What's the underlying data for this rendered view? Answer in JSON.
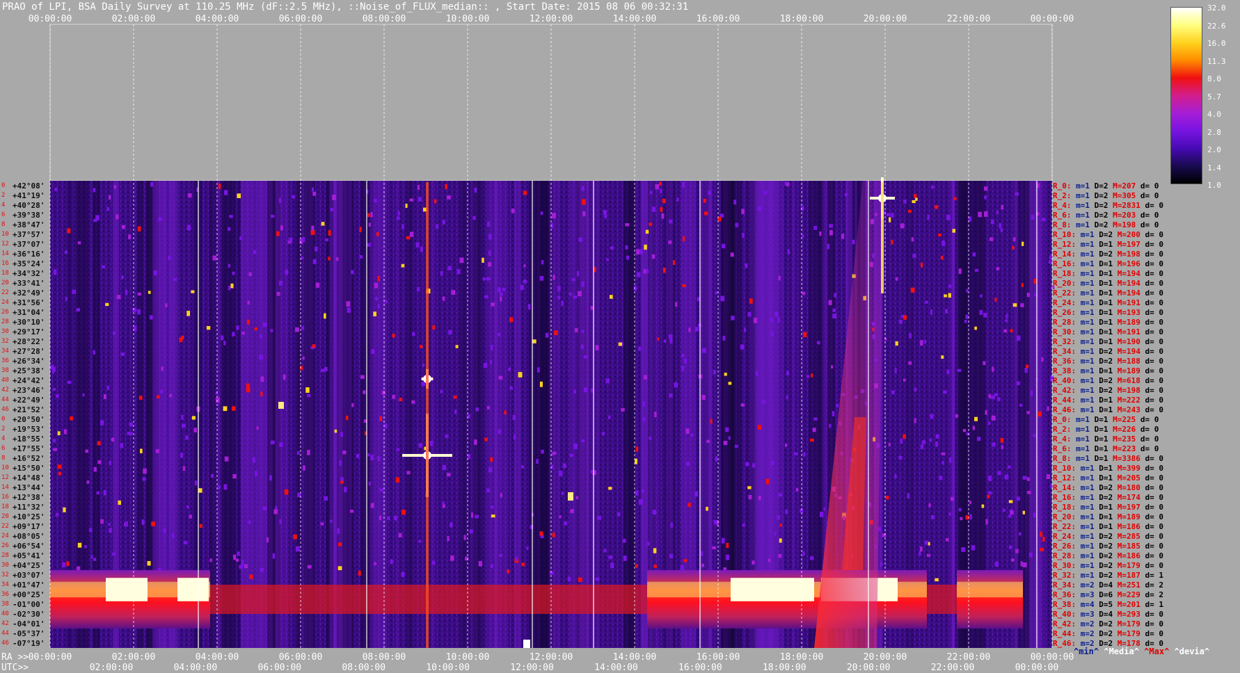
{
  "title": "PRAO of LPI, BSA Daily Survey at 110.25 MHz (dF::2.5 MHz), ::Noise_of_FLUX_median:: , Start Date: 2015 08 06 00:32:31",
  "chart_data": {
    "type": "heatmap",
    "title": "PRAO of LPI, BSA Daily Survey at 110.25 MHz (dF::2.5 MHz), ::Noise_of_FLUX_median:: , Start Date: 2015 08 06 00:32:31",
    "x_axis_top_ticks": [
      "00:00:00",
      "02:00:00",
      "04:00:00",
      "06:00:00",
      "08:00:00",
      "10:00:00",
      "12:00:00",
      "14:00:00",
      "16:00:00",
      "18:00:00",
      "20:00:00",
      "22:00:00",
      "00:00:00"
    ],
    "x_axis_bottom_ra_ticks": [
      "00:00:00",
      "02:00:00",
      "04:00:00",
      "06:00:00",
      "08:00:00",
      "10:00:00",
      "12:00:00",
      "14:00:00",
      "16:00:00",
      "18:00:00",
      "20:00:00",
      "22:00:00",
      "00:00:00"
    ],
    "x_axis_bottom_utc_ticks": [
      "02:00:00",
      "04:00:00",
      "06:00:00",
      "08:00:00",
      "10:00:00",
      "12:00:00",
      "14:00:00",
      "16:00:00",
      "18:00:00",
      "20:00:00",
      "22:00:00",
      "00:00:00"
    ],
    "ra_label": "RA >>",
    "utc_label": "UTC>>",
    "colorbar": {
      "ticks": [
        "32.0",
        "22.6",
        "16.0",
        "11.3",
        "8.0",
        "5.7",
        "4.0",
        "2.8",
        "2.0",
        "1.4",
        "1.0"
      ],
      "colors": [
        "#ffffff",
        "#ffff80",
        "#ffd21e",
        "#ff8c00",
        "#f01010",
        "#d21e8c",
        "#a51ed7",
        "#7814e1",
        "#460ab4",
        "#190a50",
        "#000000"
      ]
    },
    "declinations": [
      "+42°08'",
      "+41°19'",
      "+40°28'",
      "+39°38'",
      "+38°47'",
      "+37°57'",
      "+37°07'",
      "+36°16'",
      "+35°24'",
      "+34°32'",
      "+33°41'",
      "+32°49'",
      "+31°56'",
      "+31°04'",
      "+30°10'",
      "+29°17'",
      "+28°22'",
      "+27°28'",
      "+26°34'",
      "+25°38'",
      "+24°42'",
      "+23°46'",
      "+22°49'",
      "+21°52'",
      "+20°50'",
      "+19°53'",
      "+18°55'",
      "+17°55'",
      "+16°52'",
      "+15°50'",
      "+14°48'",
      "+13°44'",
      "+12°38'",
      "+11°32'",
      "+10°25'",
      "+09°17'",
      "+08°05'",
      "+06°54'",
      "+05°41'",
      "+04°25'",
      "+03°07'",
      "+01°47'",
      "+00°25'",
      "-01°00'",
      "-02°30'",
      "-04°01'",
      "-05°37'",
      "-07°19'"
    ],
    "row_indices": [
      "0",
      "2",
      "4",
      "6",
      "8",
      "10",
      "12",
      "14",
      "16",
      "18",
      "20",
      "22",
      "24",
      "26",
      "28",
      "30",
      "32",
      "34",
      "36",
      "38",
      "40",
      "42",
      "44",
      "46",
      "0",
      "2",
      "4",
      "6",
      "8",
      "10",
      "12",
      "14",
      "16",
      "18",
      "20",
      "22",
      "24",
      "26",
      "28",
      "30",
      "32",
      "34",
      "36",
      "38",
      "40",
      "42",
      "44",
      "46"
    ],
    "rows": [
      {
        "r": "R_0:",
        "m": "m=1",
        "D": "D=2",
        "M": "M=207",
        "d": "d= 0"
      },
      {
        "r": "R_2:",
        "m": "m=1",
        "D": "D=2",
        "M": "M=305",
        "d": "d= 0"
      },
      {
        "r": "R_4:",
        "m": "m=1",
        "D": "D=2",
        "M": "M=2831",
        "d": "d= 0"
      },
      {
        "r": "R_6:",
        "m": "m=1",
        "D": "D=2",
        "M": "M=203",
        "d": "d= 0"
      },
      {
        "r": "R_8:",
        "m": "m=1",
        "D": "D=2",
        "M": "M=198",
        "d": "d= 0"
      },
      {
        "r": "R_10:",
        "m": "m=1",
        "D": "D=2",
        "M": "M=200",
        "d": "d= 0"
      },
      {
        "r": "R_12:",
        "m": "m=1",
        "D": "D=1",
        "M": "M=197",
        "d": "d= 0"
      },
      {
        "r": "R_14:",
        "m": "m=1",
        "D": "D=2",
        "M": "M=198",
        "d": "d= 0"
      },
      {
        "r": "R_16:",
        "m": "m=1",
        "D": "D=1",
        "M": "M=196",
        "d": "d= 0"
      },
      {
        "r": "R_18:",
        "m": "m=1",
        "D": "D=1",
        "M": "M=194",
        "d": "d= 0"
      },
      {
        "r": "R_20:",
        "m": "m=1",
        "D": "D=1",
        "M": "M=194",
        "d": "d= 0"
      },
      {
        "r": "R_22:",
        "m": "m=1",
        "D": "D=1",
        "M": "M=194",
        "d": "d= 0"
      },
      {
        "r": "R_24:",
        "m": "m=1",
        "D": "D=1",
        "M": "M=191",
        "d": "d= 0"
      },
      {
        "r": "R_26:",
        "m": "m=1",
        "D": "D=1",
        "M": "M=193",
        "d": "d= 0"
      },
      {
        "r": "R_28:",
        "m": "m=1",
        "D": "D=1",
        "M": "M=189",
        "d": "d= 0"
      },
      {
        "r": "R_30:",
        "m": "m=1",
        "D": "D=1",
        "M": "M=191",
        "d": "d= 0"
      },
      {
        "r": "R_32:",
        "m": "m=1",
        "D": "D=1",
        "M": "M=190",
        "d": "d= 0"
      },
      {
        "r": "R_34:",
        "m": "m=1",
        "D": "D=2",
        "M": "M=194",
        "d": "d= 0"
      },
      {
        "r": "R_36:",
        "m": "m=1",
        "D": "D=2",
        "M": "M=188",
        "d": "d= 0"
      },
      {
        "r": "R_38:",
        "m": "m=1",
        "D": "D=1",
        "M": "M=189",
        "d": "d= 0"
      },
      {
        "r": "R_40:",
        "m": "m=1",
        "D": "D=2",
        "M": "M=618",
        "d": "d= 0"
      },
      {
        "r": "R_42:",
        "m": "m=1",
        "D": "D=2",
        "M": "M=198",
        "d": "d= 0"
      },
      {
        "r": "R_44:",
        "m": "m=1",
        "D": "D=1",
        "M": "M=222",
        "d": "d= 0"
      },
      {
        "r": "R_46:",
        "m": "m=1",
        "D": "D=1",
        "M": "M=243",
        "d": "d= 0"
      },
      {
        "r": "R_0:",
        "m": "m=1",
        "D": "D=1",
        "M": "M=225",
        "d": "d= 0"
      },
      {
        "r": "R_2:",
        "m": "m=1",
        "D": "D=1",
        "M": "M=226",
        "d": "d= 0"
      },
      {
        "r": "R_4:",
        "m": "m=1",
        "D": "D=1",
        "M": "M=235",
        "d": "d= 0"
      },
      {
        "r": "R_6:",
        "m": "m=1",
        "D": "D=1",
        "M": "M=223",
        "d": "d= 0"
      },
      {
        "r": "R_8:",
        "m": "m=1",
        "D": "D=1",
        "M": "M=3386",
        "d": "d= 0"
      },
      {
        "r": "R_10:",
        "m": "m=1",
        "D": "D=1",
        "M": "M=399",
        "d": "d= 0"
      },
      {
        "r": "R_12:",
        "m": "m=1",
        "D": "D=1",
        "M": "M=205",
        "d": "d= 0"
      },
      {
        "r": "R_14:",
        "m": "m=1",
        "D": "D=2",
        "M": "M=180",
        "d": "d= 0"
      },
      {
        "r": "R_16:",
        "m": "m=1",
        "D": "D=2",
        "M": "M=174",
        "d": "d= 0"
      },
      {
        "r": "R_18:",
        "m": "m=1",
        "D": "D=1",
        "M": "M=197",
        "d": "d= 0"
      },
      {
        "r": "R_20:",
        "m": "m=1",
        "D": "D=1",
        "M": "M=189",
        "d": "d= 0"
      },
      {
        "r": "R_22:",
        "m": "m=1",
        "D": "D=1",
        "M": "M=186",
        "d": "d= 0"
      },
      {
        "r": "R_24:",
        "m": "m=1",
        "D": "D=2",
        "M": "M=285",
        "d": "d= 0"
      },
      {
        "r": "R_26:",
        "m": "m=1",
        "D": "D=2",
        "M": "M=185",
        "d": "d= 0"
      },
      {
        "r": "R_28:",
        "m": "m=1",
        "D": "D=2",
        "M": "M=186",
        "d": "d= 0"
      },
      {
        "r": "R_30:",
        "m": "m=1",
        "D": "D=2",
        "M": "M=179",
        "d": "d= 0"
      },
      {
        "r": "R_32:",
        "m": "m=1",
        "D": "D=2",
        "M": "M=187",
        "d": "d= 1"
      },
      {
        "r": "R_34:",
        "m": "m=2",
        "D": "D=4",
        "M": "M=251",
        "d": "d= 2"
      },
      {
        "r": "R_36:",
        "m": "m=3",
        "D": "D=6",
        "M": "M=229",
        "d": "d= 2"
      },
      {
        "r": "R_38:",
        "m": "m=4",
        "D": "D=5",
        "M": "M=201",
        "d": "d= 1"
      },
      {
        "r": "R_40:",
        "m": "m=3",
        "D": "D=4",
        "M": "M=293",
        "d": "d= 0"
      },
      {
        "r": "R_42:",
        "m": "m=2",
        "D": "D=2",
        "M": "M=179",
        "d": "d= 0"
      },
      {
        "r": "R_44:",
        "m": "m=2",
        "D": "D=2",
        "M": "M=179",
        "d": "d= 0"
      },
      {
        "r": "R_46:",
        "m": "m=2",
        "D": "D=2",
        "M": "M=178",
        "d": "d= 0"
      }
    ],
    "footer_legend": {
      "min": "^min^",
      "median": "^Media^",
      "max": "^Max^",
      "devia": "^devia^"
    }
  }
}
